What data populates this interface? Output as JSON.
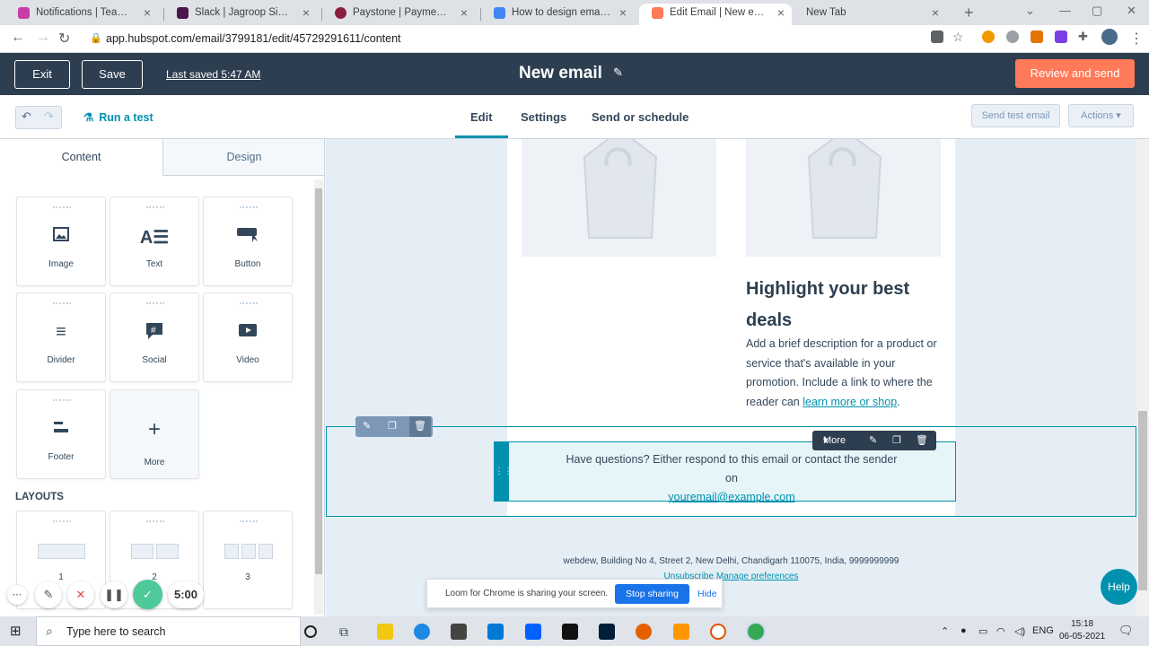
{
  "browser": {
    "tabs": [
      {
        "title": "Notifications | Team Webdew",
        "color": "#c93ba8"
      },
      {
        "title": "Slack | Jagroop Singh | webdew",
        "color": "#4a154b"
      },
      {
        "title": "Paystone | Payment Processing",
        "color": "#8b1e3f"
      },
      {
        "title": "How to design email templates",
        "color": "#4285f4"
      },
      {
        "title": "Edit Email | New email",
        "color": "#ff7a59"
      },
      {
        "title": "New Tab",
        "color": ""
      }
    ],
    "url": "app.hubspot.com/email/3799181/edit/45729291611/content"
  },
  "header": {
    "exit_label": "Exit",
    "save_label": "Save",
    "last_saved": "Last saved 5:47 AM",
    "title": "New email",
    "review_label": "Review and send",
    "accent": "#ff7a59"
  },
  "toolbar": {
    "run_test": "Run a test",
    "tabs": [
      "Edit",
      "Settings",
      "Send or schedule"
    ],
    "send_test": "Send test email",
    "actions": "Actions"
  },
  "sidebar": {
    "tabs": [
      "Content",
      "Design"
    ],
    "modules": [
      {
        "label": "Image",
        "icon": "image-icon"
      },
      {
        "label": "Text",
        "icon": "text-icon"
      },
      {
        "label": "Button",
        "icon": "button-icon"
      },
      {
        "label": "Divider",
        "icon": "divider-icon"
      },
      {
        "label": "Social",
        "icon": "social-icon"
      },
      {
        "label": "Video",
        "icon": "video-icon"
      },
      {
        "label": "Footer",
        "icon": "footer-icon"
      },
      {
        "label": "More",
        "icon": "plus-icon"
      }
    ],
    "layouts_heading": "LAYOUTS",
    "layouts": [
      "1",
      "2",
      "3"
    ]
  },
  "canvas": {
    "heading": "Highlight your best deals",
    "desc_text": "Add a brief description for a product or service that's available in your promotion. Include a link to where the reader can ",
    "desc_link": "learn more or shop",
    "desc_end": ".",
    "footer_text": "Have questions? Either respond to this email or contact the sender on",
    "footer_email": "youremail@example.com",
    "module_more": "More",
    "address": "webdew, Building No 4, Street 2, New Delhi, Chandigarh 110075, India, 9999999999",
    "unsubscribe": "Unsubscribe Manage preferences"
  },
  "loom": {
    "timer": "5:00",
    "share_msg": "Loom for Chrome is sharing your screen.",
    "stop_label": "Stop sharing",
    "hide_label": "Hide"
  },
  "help_label": "Help",
  "taskbar": {
    "search_placeholder": "Type here to search",
    "lang": "ENG",
    "time": "15:18",
    "date": "06-05-2021"
  }
}
